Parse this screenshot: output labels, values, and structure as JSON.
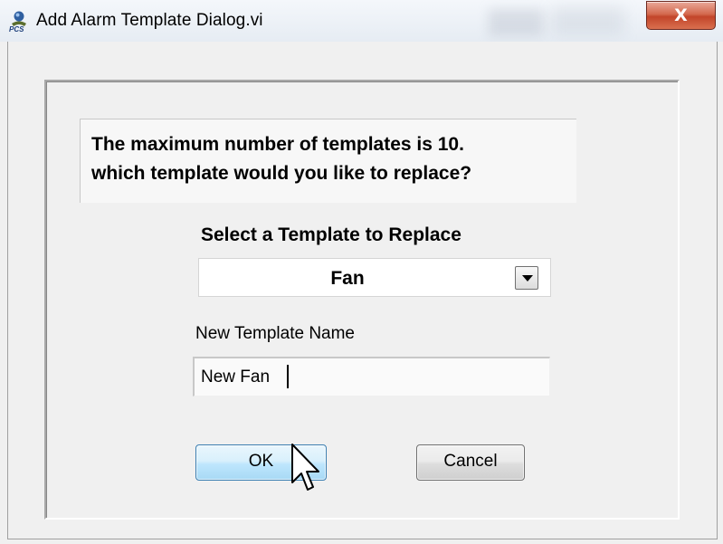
{
  "window": {
    "title": "Add Alarm Template Dialog.vi",
    "icon": "app-logo-icon",
    "close_glyph": "X",
    "close_color": "#c7442b"
  },
  "message": {
    "line1": "The maximum number of templates is 10.",
    "line2": "which template would you like to replace?"
  },
  "template_select": {
    "label": "Select a Template to Replace",
    "selected": "Fan"
  },
  "new_name": {
    "label": "New Template Name",
    "value": "New Fan"
  },
  "buttons": {
    "ok": "OK",
    "cancel": "Cancel"
  },
  "colors": {
    "ok_button_accent": "#3c7fb1",
    "background": "#f0f0f0"
  }
}
